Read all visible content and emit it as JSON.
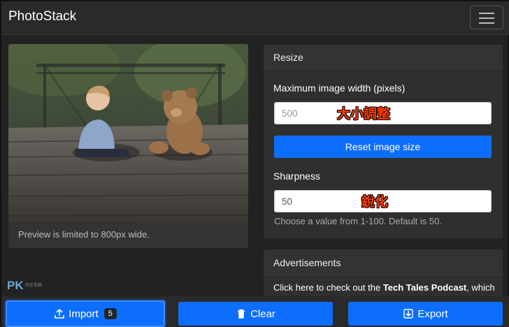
{
  "app": {
    "title": "PhotoStack"
  },
  "preview": {
    "note": "Preview is limited to 800px wide."
  },
  "resize": {
    "header": "Resize",
    "width_label": "Maximum image width (pixels)",
    "width_placeholder": "500",
    "reset_button": "Reset image size",
    "sharpness_label": "Sharpness",
    "sharpness_value": "50",
    "sharpness_help": "Choose a value from 1-100. Default is 50."
  },
  "overlays": {
    "resize_tag": "大小調整",
    "sharpness_tag": "銳化"
  },
  "ads": {
    "header": "Advertisements",
    "text_prefix": "Click here to check out the ",
    "text_bold": "Tech Tales Podcast",
    "text_suffix": ", which"
  },
  "watermark": {
    "logo": "PK",
    "tagline": "阿正老師"
  },
  "toolbar": {
    "import_label": "Import",
    "import_count": "5",
    "clear_label": "Clear",
    "export_label": "Export"
  },
  "colors": {
    "accent": "#0d6efd",
    "background": "#222222",
    "panel": "#2f2f2f"
  },
  "icons": [
    "menu-icon",
    "upload-icon",
    "trash-icon",
    "download-icon"
  ]
}
